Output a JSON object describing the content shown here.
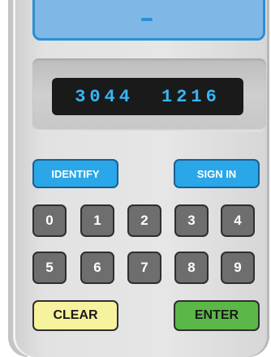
{
  "display": {
    "group_1": "3044",
    "group_2": "1216"
  },
  "buttons": {
    "identify": "IDENTIFY",
    "sign_in": "SIGN IN",
    "clear": "CLEAR",
    "enter": "ENTER"
  },
  "keypad": {
    "keys": [
      "0",
      "1",
      "2",
      "3",
      "4",
      "5",
      "6",
      "7",
      "8",
      "9"
    ]
  },
  "colors": {
    "accent_blue": "#2aa7e8",
    "display_digits": "#38b6f5",
    "clear_yellow": "#f7f29e",
    "enter_green": "#5bb747",
    "key_gray": "#6e6e6e"
  }
}
